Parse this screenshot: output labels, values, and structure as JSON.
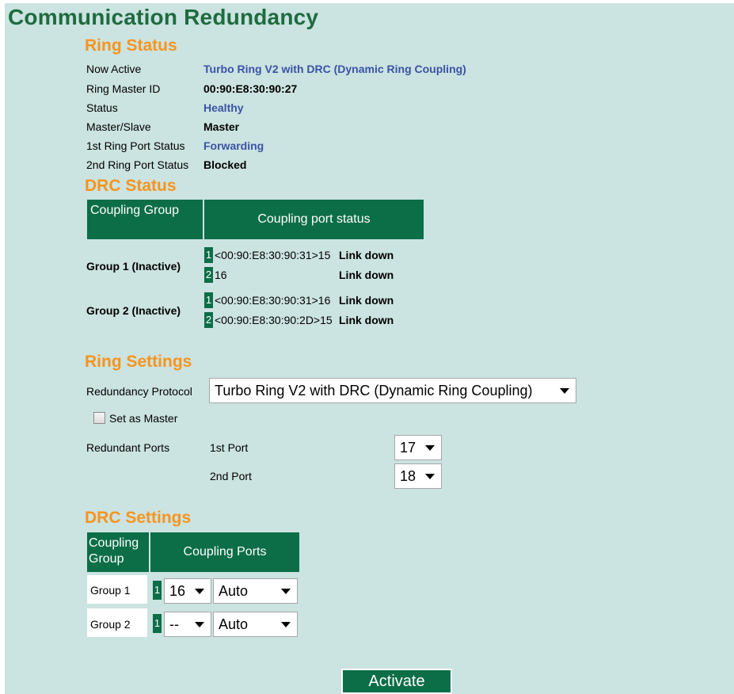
{
  "page": {
    "title": "Communication Redundancy"
  },
  "ring_status": {
    "title": "Ring Status",
    "rows": [
      {
        "label": "Now Active",
        "value": "Turbo Ring V2 with DRC (Dynamic Ring Coupling)",
        "color": "#3a53a4"
      },
      {
        "label": "Ring Master ID",
        "value": "00:90:E8:30:90:27",
        "color": "#000000"
      },
      {
        "label": "Status",
        "value": "Healthy",
        "color": "#3a53a4"
      },
      {
        "label": "Master/Slave",
        "value": "Master",
        "color": "#000000"
      },
      {
        "label": "1st Ring Port Status",
        "value": "Forwarding",
        "color": "#3a53a4"
      },
      {
        "label": "2nd Ring Port Status",
        "value": "Blocked",
        "color": "#000000"
      }
    ]
  },
  "drc_status": {
    "title": "DRC Status",
    "headers": {
      "group": "Coupling Group",
      "port_status": "Coupling port status"
    },
    "groups": [
      {
        "label": "Group 1 (Inactive)",
        "ports": [
          {
            "index": "1",
            "port": "<00:90:E8:30:90:31>15",
            "status": "Link down"
          },
          {
            "index": "2",
            "port": "16",
            "status": "Link down"
          }
        ]
      },
      {
        "label": "Group 2 (Inactive)",
        "ports": [
          {
            "index": "1",
            "port": "<00:90:E8:30:90:31>16",
            "status": "Link down"
          },
          {
            "index": "2",
            "port": "<00:90:E8:30:90:2D>15",
            "status": "Link down"
          }
        ]
      }
    ]
  },
  "ring_settings": {
    "title": "Ring Settings",
    "protocol_label": "Redundancy Protocol",
    "protocol_value": "Turbo Ring V2 with DRC (Dynamic Ring Coupling)",
    "master_label": "Set as Master",
    "master_checked": false,
    "redundant_ports_label": "Redundant Ports",
    "first_port_label": "1st Port",
    "first_port_value": "17",
    "second_port_label": "2nd Port",
    "second_port_value": "18"
  },
  "drc_settings": {
    "title": "DRC Settings",
    "headers": {
      "group": "Coupling Group",
      "ports": "Coupling Ports"
    },
    "rows": [
      {
        "group": "Group 1",
        "index": "1",
        "port": "16",
        "mode": "Auto"
      },
      {
        "group": "Group 2",
        "index": "1",
        "port": "--",
        "mode": "Auto"
      }
    ]
  },
  "actions": {
    "activate_label": "Activate"
  },
  "colors": {
    "background": "#cbe3e1",
    "accent_green": "#0c6e47",
    "title_green": "#1e6b3f",
    "section_orange": "#f7941d",
    "value_blue": "#3a53a4"
  },
  "icons": {
    "dropdown": "chevron-down-icon",
    "checkbox": "checkbox-icon"
  }
}
